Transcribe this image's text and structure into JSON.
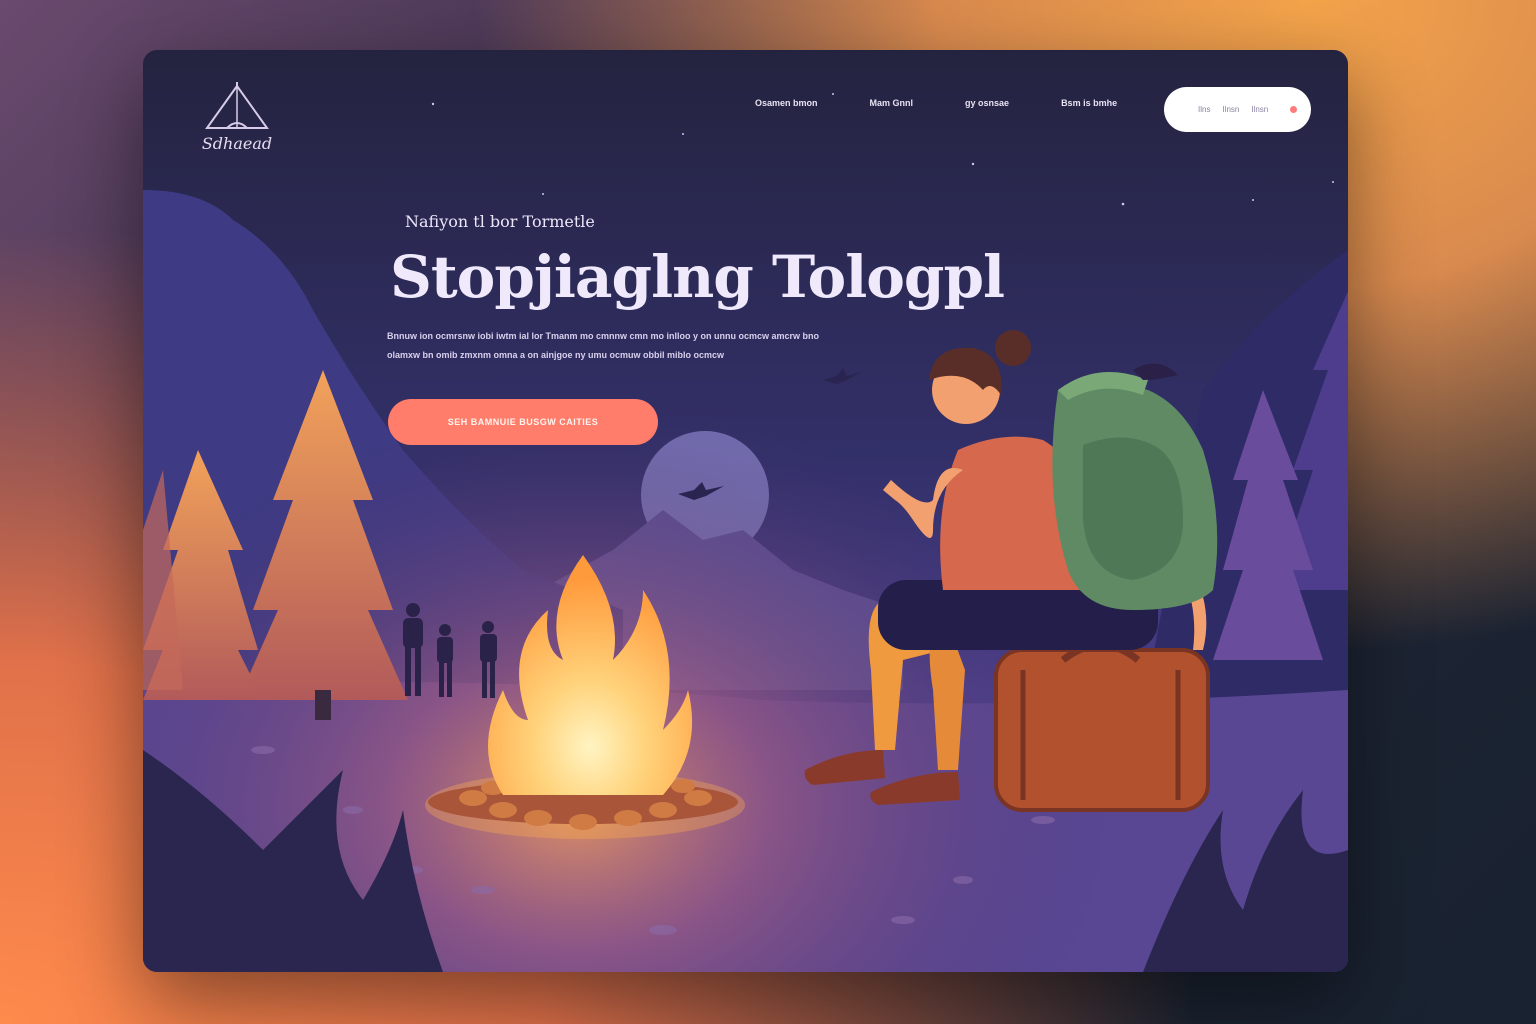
{
  "brand": {
    "logo_text": "Sdhaead"
  },
  "nav": {
    "items": [
      {
        "label": "Osamen bmon"
      },
      {
        "label": "Mam Gnnl"
      },
      {
        "label": "gy osnsae"
      },
      {
        "label": "Bsm is bmhe"
      }
    ]
  },
  "account_pill": {
    "item1": "Ilns",
    "item2": "Ilnsn",
    "item3": "Ilnsn"
  },
  "hero": {
    "eyebrow": "Nafiyon tl bor Tormetle",
    "title": "Stopjiagln‌g Tologpl",
    "description": "Bnnuw ion ocmrsnw iobi iwtm ial lor Tmanm mo cmnnw cmn mo inlloo y on unnu ocmcw amcrw bno olamxw bn omib zmxnm omna a on ainjgoe ny umu ocmuw obbil miblo ocmcw",
    "cta_label": "SEH BAMNUIE BUSGW CAITIES"
  },
  "colors": {
    "accent": "#ff7d6a",
    "sky": "#2b2850",
    "fire": "#ffb04a"
  }
}
